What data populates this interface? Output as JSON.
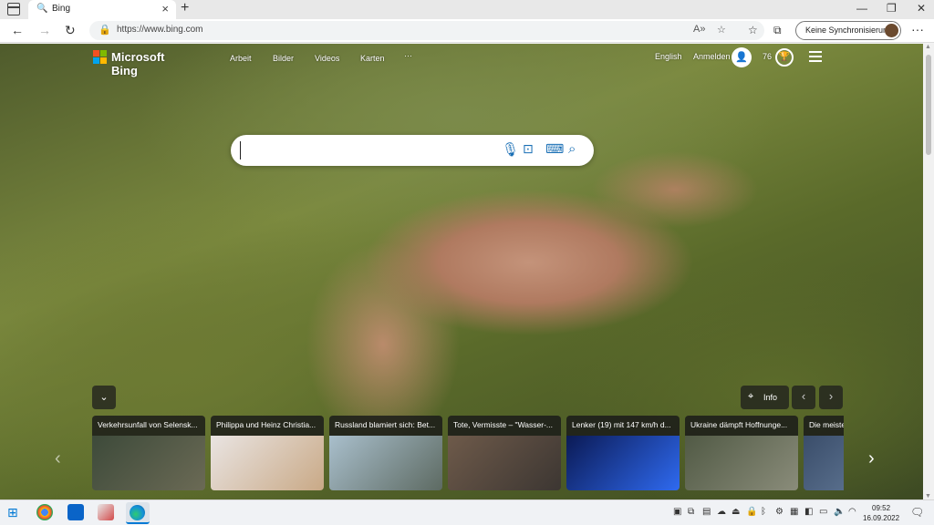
{
  "tab": {
    "title": "Bing"
  },
  "address": {
    "url": "https://www.bing.com"
  },
  "toolbar": {
    "sync_label": "Keine Synchronisierung"
  },
  "bing": {
    "logo_text": "Microsoft Bing",
    "nav": [
      "Arbeit",
      "Bilder",
      "Videos",
      "Karten",
      "···"
    ],
    "language": "English",
    "sign_in": "Anmelden",
    "reward_points": "76"
  },
  "search": {
    "placeholder": ""
  },
  "info_label": "Info",
  "news": [
    {
      "title": "Verkehrsunfall von Selensk...",
      "img": [
        "#3d4a3a",
        "#6b6a55"
      ]
    },
    {
      "title": "Philippa und Heinz Christia...",
      "img": [
        "#e9e4e2",
        "#c9a986"
      ]
    },
    {
      "title": "Russland blamiert sich: Bet...",
      "img": [
        "#a9bfcc",
        "#5d6a62"
      ]
    },
    {
      "title": "Tote, Vermisste – \"Wasser-...",
      "img": [
        "#6e5a4a",
        "#3c3632"
      ]
    },
    {
      "title": "Lenker (19) mit 147 km/h d...",
      "img": [
        "#0b1a55",
        "#2f6af0"
      ]
    },
    {
      "title": "Ukraine dämpft Hoffnunge...",
      "img": [
        "#515a45",
        "#8a8c7a"
      ]
    },
    {
      "title": "Die meister",
      "img": [
        "#3a4d6a",
        "#6e86a4"
      ]
    }
  ],
  "clock": {
    "time": "09:52",
    "date": "16.09.2022"
  }
}
